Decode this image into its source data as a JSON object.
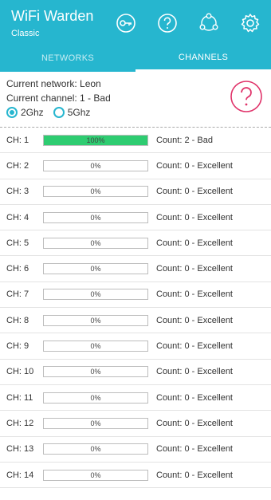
{
  "app": {
    "title": "WiFi Warden",
    "subtitle": "Classic"
  },
  "toolbar": {
    "actions": [
      {
        "icon": "key-icon"
      },
      {
        "icon": "help-icon"
      },
      {
        "icon": "share-icon"
      },
      {
        "icon": "gear-icon"
      }
    ]
  },
  "tabs": [
    {
      "label": "NETWORKS",
      "active": false
    },
    {
      "label": "CHANNELS",
      "active": true
    }
  ],
  "info": {
    "current_network": "Current network: Leon",
    "current_channel": "Current channel: 1 - Bad",
    "bands": [
      {
        "label": "2Ghz",
        "checked": true
      },
      {
        "label": "5Ghz",
        "checked": false
      }
    ]
  },
  "colors": {
    "accent": "#26b6cf",
    "bar_fill": "#2ecc71",
    "help_badge": "#e0336a"
  },
  "channels": [
    {
      "label": "CH: 1",
      "percent_text": "100%",
      "fill": 1.0,
      "count": "Count: 2 - Bad"
    },
    {
      "label": "CH: 2",
      "percent_text": "0%",
      "fill": 0,
      "count": "Count: 0 - Excellent"
    },
    {
      "label": "CH: 3",
      "percent_text": "0%",
      "fill": 0,
      "count": "Count: 0 - Excellent"
    },
    {
      "label": "CH: 4",
      "percent_text": "0%",
      "fill": 0,
      "count": "Count: 0 - Excellent"
    },
    {
      "label": "CH: 5",
      "percent_text": "0%",
      "fill": 0,
      "count": "Count: 0 - Excellent"
    },
    {
      "label": "CH: 6",
      "percent_text": "0%",
      "fill": 0,
      "count": "Count: 0 - Excellent"
    },
    {
      "label": "CH: 7",
      "percent_text": "0%",
      "fill": 0,
      "count": "Count: 0 - Excellent"
    },
    {
      "label": "CH: 8",
      "percent_text": "0%",
      "fill": 0,
      "count": "Count: 0 - Excellent"
    },
    {
      "label": "CH: 9",
      "percent_text": "0%",
      "fill": 0,
      "count": "Count: 0 - Excellent"
    },
    {
      "label": "CH: 10",
      "percent_text": "0%",
      "fill": 0,
      "count": "Count: 0 - Excellent"
    },
    {
      "label": "CH: 11",
      "percent_text": "0%",
      "fill": 0,
      "count": "Count: 0 - Excellent"
    },
    {
      "label": "CH: 12",
      "percent_text": "0%",
      "fill": 0,
      "count": "Count: 0 - Excellent"
    },
    {
      "label": "CH: 13",
      "percent_text": "0%",
      "fill": 0,
      "count": "Count: 0 - Excellent"
    },
    {
      "label": "CH: 14",
      "percent_text": "0%",
      "fill": 0,
      "count": "Count: 0 - Excellent"
    }
  ]
}
